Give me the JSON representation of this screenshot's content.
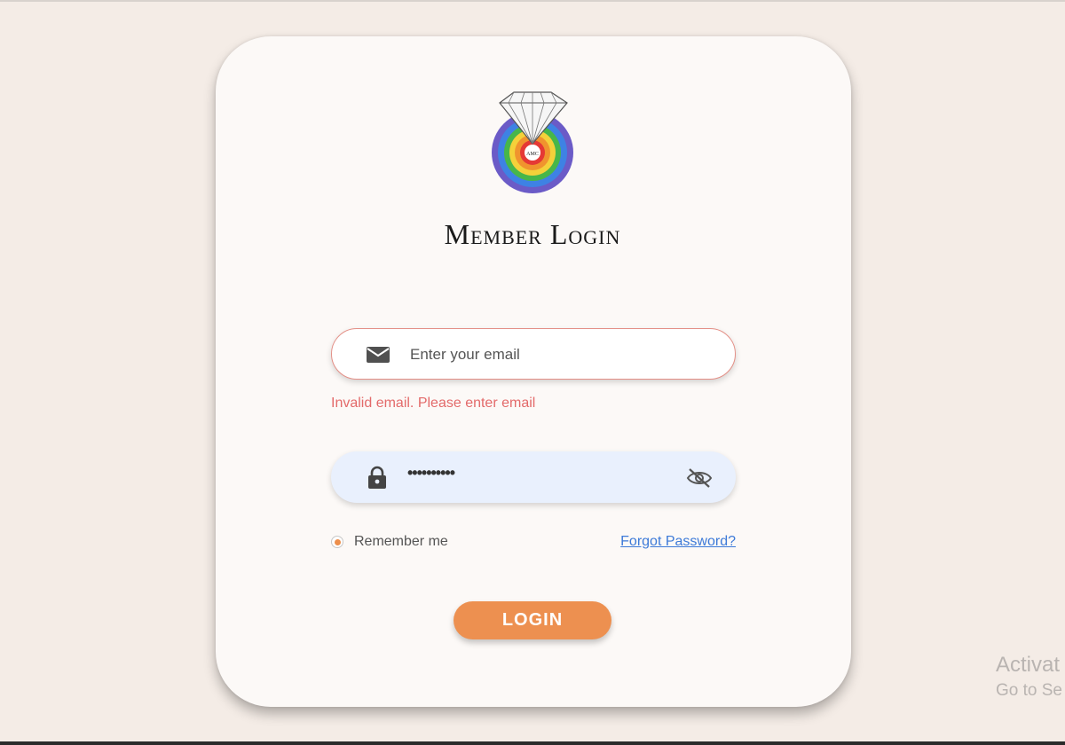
{
  "login_card": {
    "title": "Member Login",
    "logo": {
      "text": "AMC",
      "icon": "diamond-ring-logo",
      "rings": [
        "#6b5bc7",
        "#3e82e4",
        "#47b64a",
        "#f4d13a",
        "#f0942e",
        "#e53935"
      ]
    },
    "email": {
      "icon": "envelope-icon",
      "placeholder": "Enter your email",
      "value": "",
      "error": "Invalid email. Please enter email"
    },
    "password": {
      "icon": "lock-icon",
      "masked_value": "••••••••••",
      "toggle_icon": "eye-slash-icon"
    },
    "remember_me": {
      "label": "Remember me",
      "checked": true
    },
    "forgot_password": "Forgot Password?",
    "login_button": "LOGIN"
  },
  "watermark": {
    "line1": "Activat",
    "line2": "Go to Se"
  },
  "colors": {
    "background": "#f4ece6",
    "card": "#fcf9f7",
    "accent": "#ed9050",
    "error": "#e36a6a",
    "link": "#3d7ad8",
    "password_field": "#e9f0fd",
    "email_border": "#e48f86"
  }
}
